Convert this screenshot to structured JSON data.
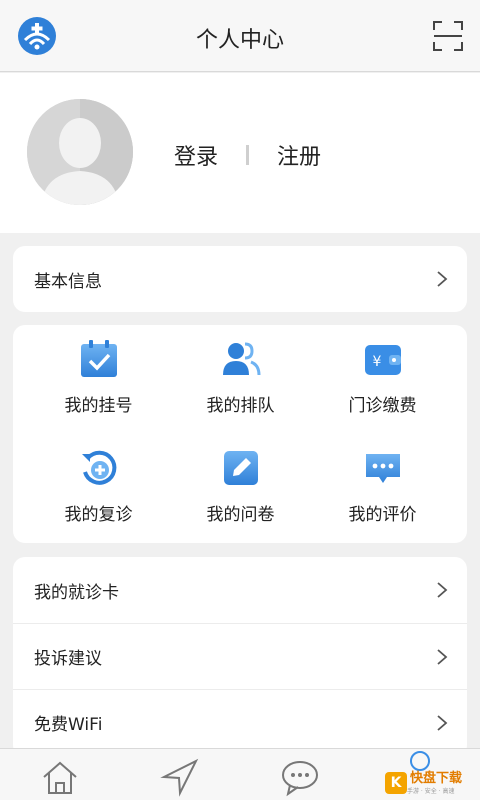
{
  "header": {
    "title": "个人中心",
    "logo_icon": "hospital-logo-icon",
    "scan_icon": "scan-icon"
  },
  "profile": {
    "avatar_icon": "default-avatar-icon",
    "login_label": "登录",
    "register_label": "注册"
  },
  "basic_info": {
    "label": "基本信息"
  },
  "services": [
    {
      "label": "我的挂号",
      "icon": "calendar-check-icon"
    },
    {
      "label": "我的排队",
      "icon": "queue-people-icon"
    },
    {
      "label": "门诊缴费",
      "icon": "wallet-yuan-icon"
    },
    {
      "label": "我的复诊",
      "icon": "revisit-plus-icon"
    },
    {
      "label": "我的问卷",
      "icon": "questionnaire-edit-icon"
    },
    {
      "label": "我的评价",
      "icon": "comment-bubble-icon"
    }
  ],
  "menu": [
    {
      "label": "我的就诊卡"
    },
    {
      "label": "投诉建议"
    },
    {
      "label": "免费WiFi"
    }
  ],
  "tabbar": {
    "tabs": [
      {
        "icon": "home-icon"
      },
      {
        "icon": "navigation-icon"
      },
      {
        "icon": "message-icon"
      },
      {
        "icon": "profile-icon"
      }
    ]
  },
  "watermark": {
    "logo": "K",
    "title": "快盘下载",
    "subtitle": "手游 · 安全 · 高速"
  },
  "colors": {
    "accent": "#3a8ee6",
    "accent_light": "#6fb3f2"
  }
}
